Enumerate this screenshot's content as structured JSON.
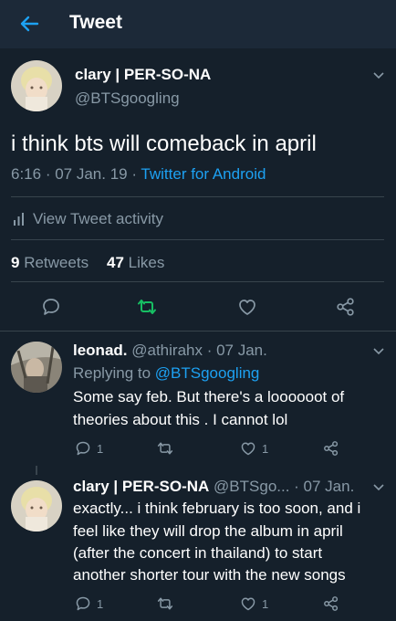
{
  "header": {
    "title": "Tweet"
  },
  "main_tweet": {
    "display_name": "clary | PER-SO-NA",
    "handle": "@BTSgoogling",
    "text": "i think bts will comeback in april",
    "time": "6:16",
    "date_sep": " · ",
    "date": "07 Jan. 19",
    "source_sep": " · ",
    "source": "Twitter for Android",
    "activity_label": "View Tweet activity",
    "retweets_count": "9",
    "retweets_label": "Retweets",
    "likes_count": "47",
    "likes_label": "Likes"
  },
  "reply1": {
    "display_name": "leonad.",
    "meta": "@athirahx · 07 Jan.",
    "replying_prefix": "Replying to ",
    "replying_handle": "@BTSgoogling",
    "lines": [
      "Some say feb. But there's a loooooot of",
      "theories about this . I cannot lol"
    ],
    "reply_count": "1",
    "like_count": "1"
  },
  "reply2": {
    "display_name": "clary | PER-SO-NA",
    "meta": "@BTSgo... · 07 Jan.",
    "lines": [
      "exactly... i think february is too soon, and i",
      "feel like they will drop the album in april",
      "(after the concert in thailand) to start",
      "another shorter tour with the new songs"
    ],
    "reply_count": "1",
    "like_count": "1"
  },
  "colors": {
    "background": "#15202b",
    "header": "#1c2938",
    "accent": "#1da1f2",
    "muted": "#8899a6",
    "retweet_green": "#17bf63"
  },
  "icons": [
    "back-arrow-icon",
    "chevron-down-icon",
    "reply-icon",
    "retweet-icon",
    "heart-icon",
    "share-icon",
    "bar-chart-icon"
  ]
}
